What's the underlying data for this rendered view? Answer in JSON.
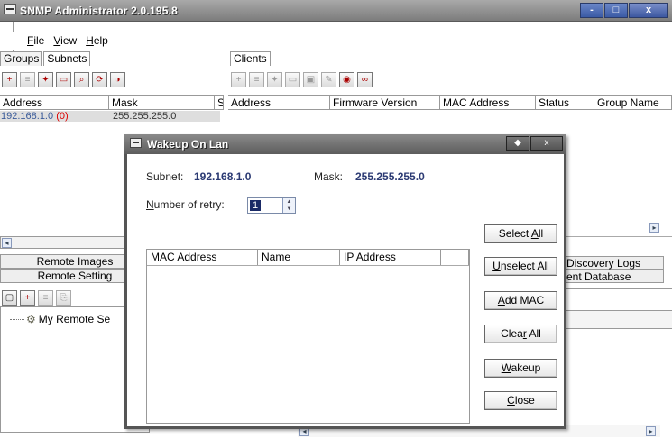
{
  "app": {
    "title": "SNMP Administrator 2.0.195.8",
    "window_buttons": [
      "-",
      "□",
      "x"
    ]
  },
  "menu": [
    {
      "label": "File",
      "accel": "F"
    },
    {
      "label": "View",
      "accel": "V"
    },
    {
      "label": "Help",
      "accel": "H"
    }
  ],
  "left_tabs": [
    "Groups",
    "Subnets"
  ],
  "left_grid": {
    "columns": [
      "Address",
      "Mask",
      "S"
    ],
    "rows": [
      {
        "address": "192.168.1.0",
        "count": "(0)",
        "mask": "255.255.255.0"
      }
    ]
  },
  "right_tab": "Clients",
  "right_grid": {
    "columns": [
      "Address",
      "Firmware Version",
      "MAC Address",
      "Status",
      "Group Name"
    ]
  },
  "remote_buttons": [
    "Remote Images",
    "Remote Setting"
  ],
  "tree": {
    "item": "My Remote Se"
  },
  "right_bottom_tabs": [
    "Discovery Logs",
    "ent Database"
  ],
  "dialog": {
    "title": "Wakeup On Lan",
    "subnet_label": "Subnet:",
    "subnet_value": "192.168.1.0",
    "mask_label": "Mask:",
    "mask_value": "255.255.255.0",
    "retry_label": "Number of retry:",
    "retry_value": "1",
    "list_columns": [
      "MAC Address",
      "Name",
      "IP Address"
    ],
    "buttons": {
      "select_all": "Select All",
      "unselect_all": "Unselect All",
      "add_mac": "Add MAC",
      "clear_all": "Clear All",
      "wakeup": "Wakeup",
      "close": "Close"
    }
  }
}
